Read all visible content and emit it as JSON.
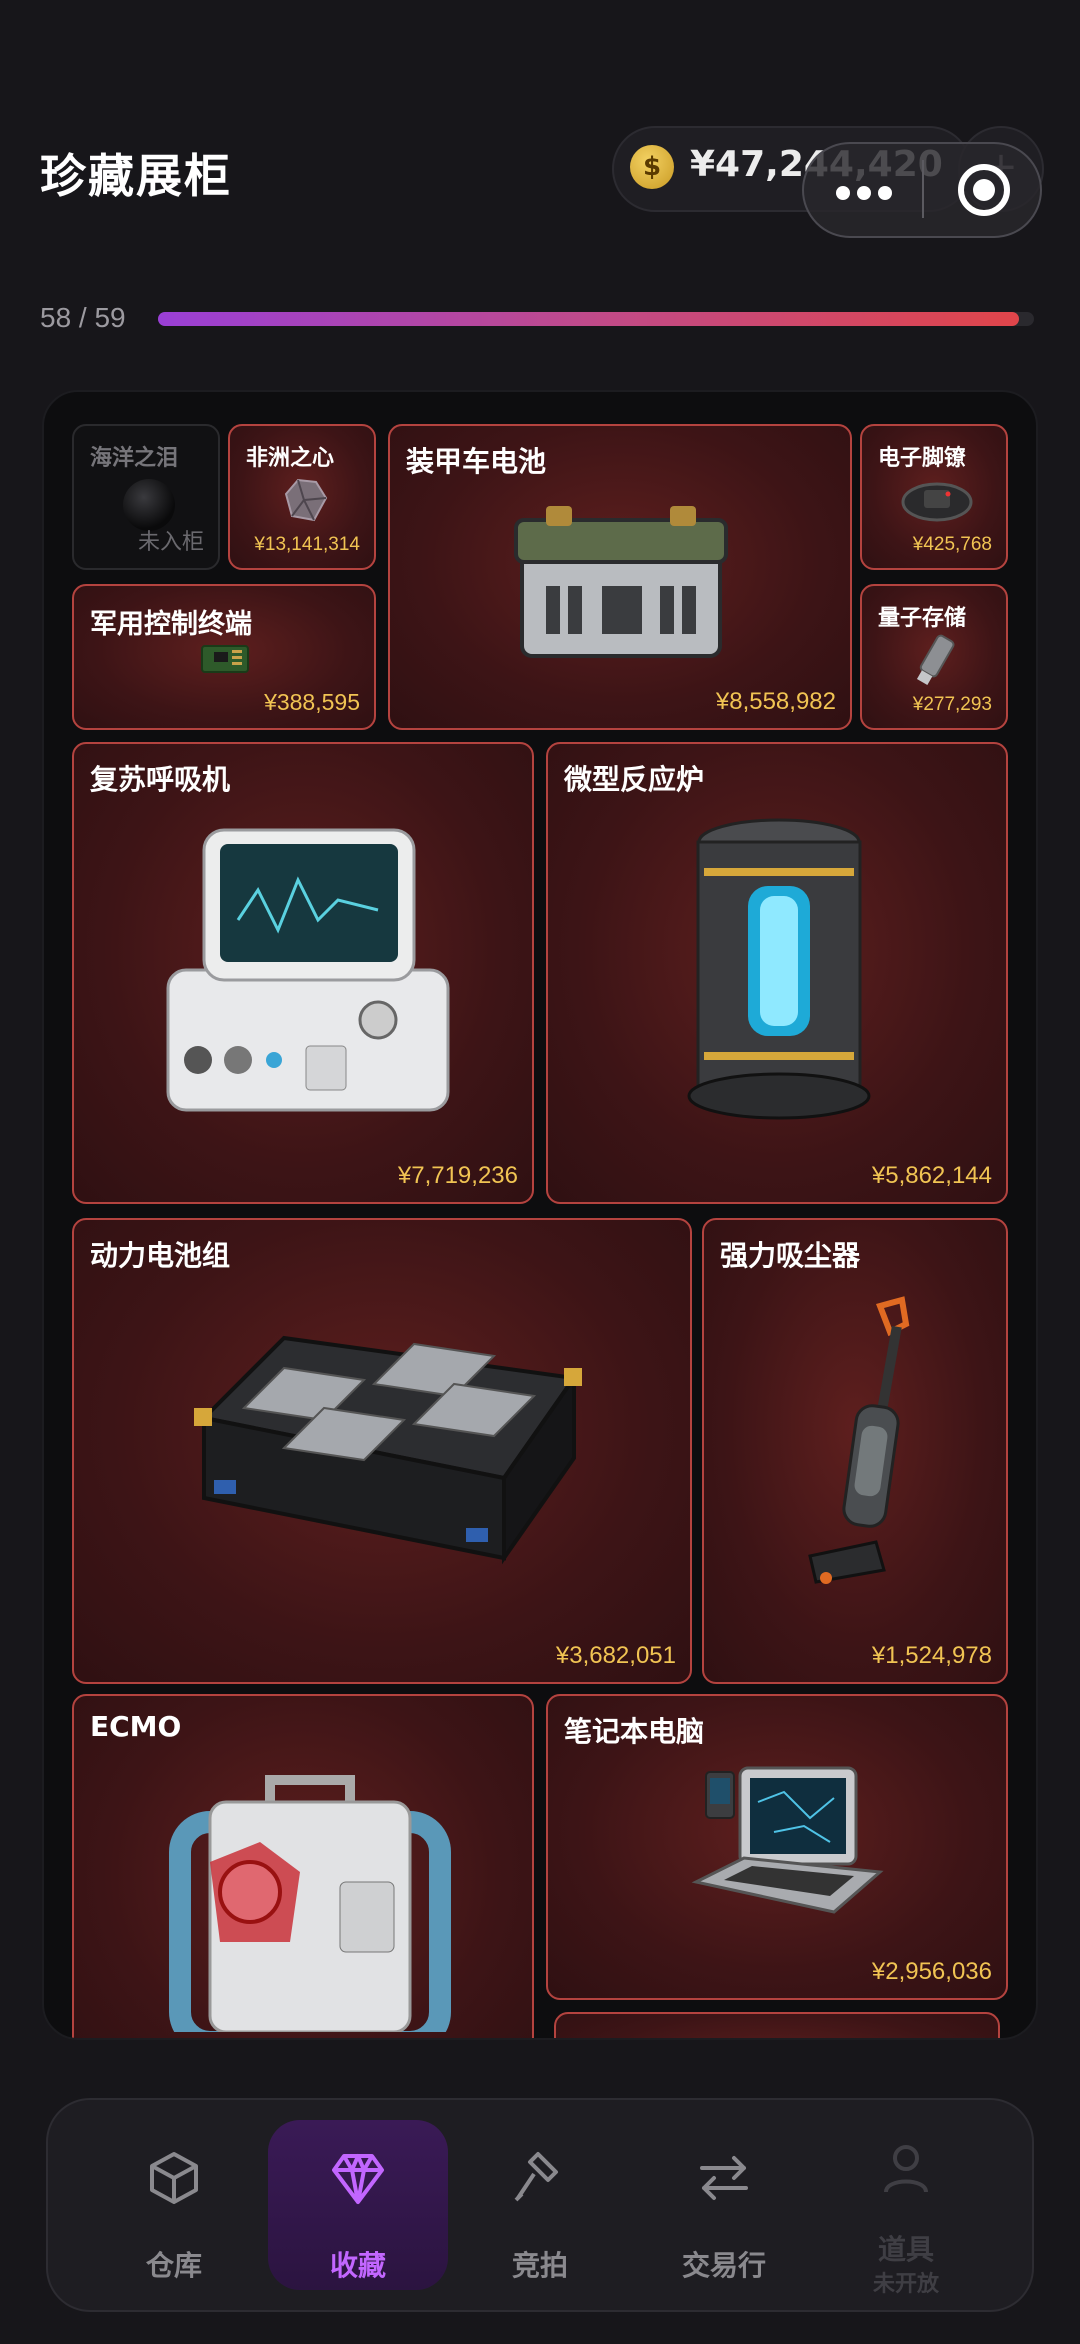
{
  "header": {
    "title": "珍藏展柜",
    "currency_symbol": "$",
    "balance": "¥47,244,420",
    "add_button": "+"
  },
  "progress": {
    "label": "58 / 59",
    "collected": 58,
    "total": 59
  },
  "items": [
    {
      "name": "海洋之泪",
      "status": "未入柜",
      "locked": true,
      "icon": "black-pearl"
    },
    {
      "name": "非洲之心",
      "price": "¥13,141,314",
      "icon": "gemstone"
    },
    {
      "name": "装甲车电池",
      "price": "¥8,558,982",
      "icon": "armored-battery"
    },
    {
      "name": "电子脚镣",
      "price": "¥425,768",
      "icon": "electronic-shackle"
    },
    {
      "name": "军用控制终端",
      "price": "¥388,595",
      "icon": "circuit-board"
    },
    {
      "name": "量子存储",
      "price": "¥277,293",
      "icon": "usb-drive"
    },
    {
      "name": "复苏呼吸机",
      "price": "¥7,719,236",
      "icon": "ventilator"
    },
    {
      "name": "微型反应炉",
      "price": "¥5,862,144",
      "icon": "mini-reactor"
    },
    {
      "name": "动力电池组",
      "price": "¥3,682,051",
      "icon": "battery-pack"
    },
    {
      "name": "强力吸尘器",
      "price": "¥1,524,978",
      "icon": "vacuum-cleaner"
    },
    {
      "name": "ECMO",
      "price": "",
      "icon": "ecmo-machine"
    },
    {
      "name": "笔记本电脑",
      "price": "¥2,956,036",
      "icon": "rugged-laptop"
    }
  ],
  "nav": [
    {
      "label": "仓库",
      "icon": "box-icon"
    },
    {
      "label": "收藏",
      "icon": "diamond-icon",
      "active": true
    },
    {
      "label": "竞拍",
      "icon": "gavel-icon"
    },
    {
      "label": "交易行",
      "icon": "swap-icon"
    },
    {
      "label": "道具",
      "sub": "未开放",
      "icon": "user-icon",
      "disabled": true
    }
  ],
  "colors": {
    "accent": "#c266ff",
    "price": "#f1c453",
    "card_border": "#b4433f",
    "background": "#17161a"
  }
}
